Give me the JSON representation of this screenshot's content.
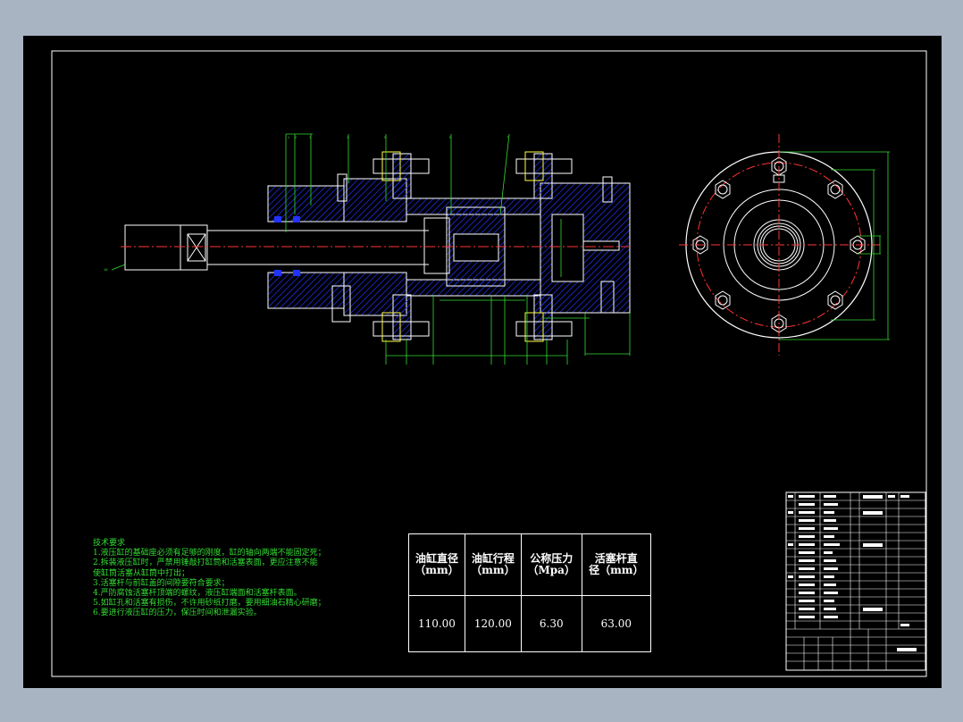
{
  "technical_requirements": {
    "heading": "技术要求",
    "items": [
      "1.液压缸的基础座必须有足够的刚度，缸的轴向两端不能固定死；",
      "2.拆装液压缸时，严禁用锤敲打缸筒和活塞表面，更应注意不能",
      "   使缸筒活塞从缸筒中打出；",
      "3.活塞杆与前缸盖的间隙要符合要求；",
      "4.严防腐蚀活塞杆顶端的螺纹，液压缸端面和活塞杆表面。",
      "5.如缸孔和活塞有损伤，不许用砂纸打磨，要用细油石精心研磨；",
      "6.要进行液压缸的压力，保压时间和泄漏实验。"
    ]
  },
  "spec_table": {
    "headers": [
      "油缸直径\n（mm）",
      "油缸行程\n（mm）",
      "公称压力\n（Mpa）",
      "活塞杆直\n径（mm）"
    ],
    "values": [
      "110.00",
      "120.00",
      "6.30",
      "63.00"
    ]
  },
  "colors": {
    "background": "#a9b4c3",
    "canvas": "#000000",
    "outline": "#ffffff",
    "hatch": "#2233ff",
    "dimension": "#33dd33",
    "center_line": "#ff3333",
    "wire": "#ffff44"
  }
}
